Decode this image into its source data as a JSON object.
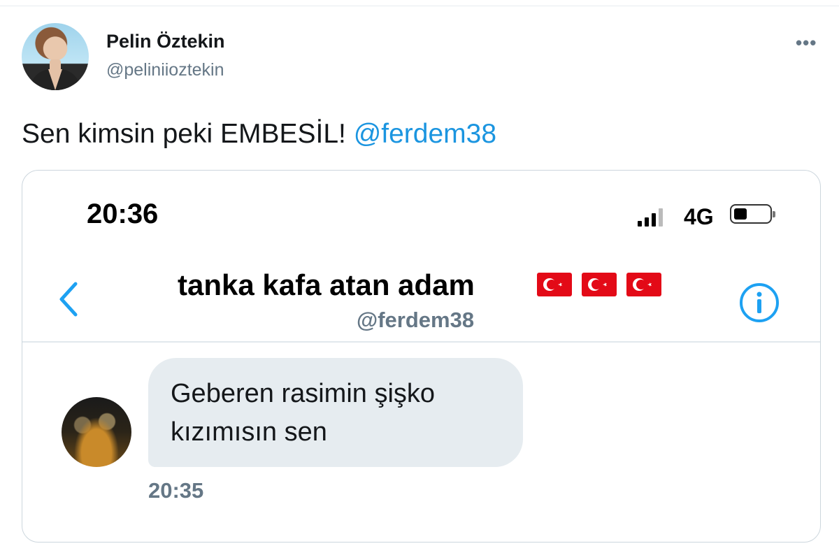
{
  "tweet": {
    "author_name": "Pelin Öztekin",
    "author_handle": "@peliniioztekin",
    "more_icon": "more-horizontal-icon",
    "text": "Sen kimsin peki EMBESİL! ",
    "mention": "@ferdem38"
  },
  "screenshot": {
    "status_bar": {
      "time": "20:36",
      "network": "4G"
    },
    "chat_header": {
      "title": "tanka kafa atan adam",
      "handle": "@ferdem38",
      "flag_count": 3
    },
    "message": {
      "text": "Geberen rasimin şişko kızımısın sen",
      "time": "20:35"
    }
  },
  "colors": {
    "mention": "#1b95e0",
    "icon_blue": "#1da1f2",
    "muted": "#657786",
    "bubble": "#e6ecf0",
    "flag_red": "#e30a17"
  }
}
